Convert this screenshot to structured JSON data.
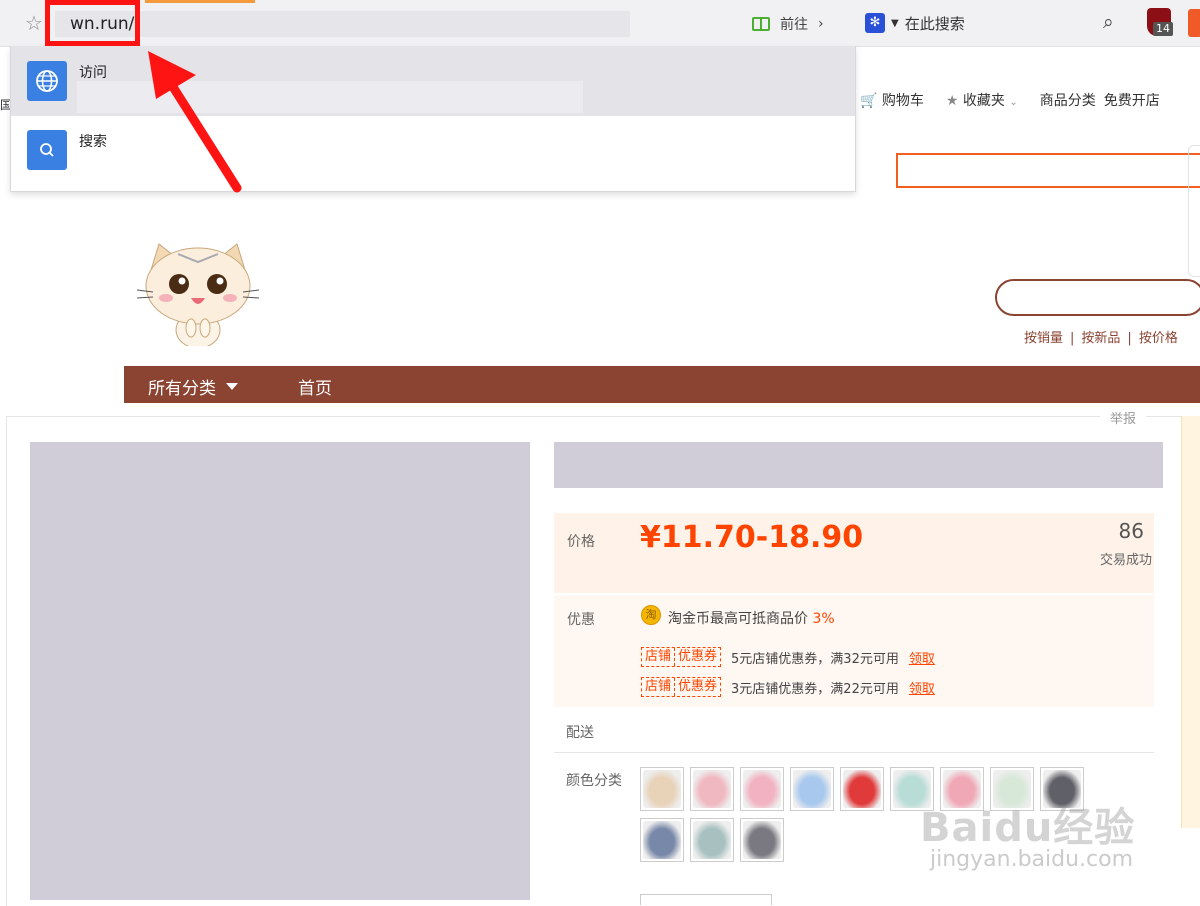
{
  "browser": {
    "url": "wn.run/",
    "go_label": "前往",
    "go_chevron": "›",
    "search_engine_placeholder": "在此搜索",
    "extension_badge": "14",
    "dropdown": {
      "visit_label": "访问",
      "search_label": "搜索"
    }
  },
  "page": {
    "top_nav": {
      "cart": "购物车",
      "favorites": "收藏夹",
      "categories": "商品分类",
      "open_shop": "免费开店"
    },
    "left_edge_text": "国",
    "sort_links": [
      "按销量",
      "按新品",
      "按价格"
    ],
    "shop_nav": {
      "all_categories": "所有分类",
      "home": "首页"
    },
    "report": "举报",
    "price": {
      "label": "价格",
      "value": "¥11.70-18.90",
      "sales_count": "86",
      "sales_label": "交易成功"
    },
    "promo": {
      "label": "优惠",
      "coin_icon_text": "淘",
      "coin_text": "淘金币最高可抵商品价",
      "coin_percent": "3%",
      "coupons": [
        {
          "tag_a": "店铺",
          "tag_b": "优惠券",
          "text": "5元店铺优惠券，满32元可用",
          "claim": "领取"
        },
        {
          "tag_a": "店铺",
          "tag_b": "优惠券",
          "text": "3元店铺优惠券，满22元可用",
          "claim": "领取"
        }
      ]
    },
    "shipping_label": "配送",
    "color_label": "颜色分类",
    "swatch_colors": [
      "#e8d2b8",
      "#f0b8c0",
      "#f2b2c2",
      "#a8c8ee",
      "#e03a3a",
      "#b8dcd6",
      "#f0a8b6",
      "#d8e8d8",
      "#606068",
      "#7888a8",
      "#a8c0c0",
      "#7a7880"
    ],
    "watermark": "Baidu经验",
    "watermark_sub": "jingyan.baidu.com"
  },
  "colors": {
    "brand_orange": "#ff4400",
    "shop_nav": "#8b4332",
    "annotation_red": "#ff1414"
  }
}
